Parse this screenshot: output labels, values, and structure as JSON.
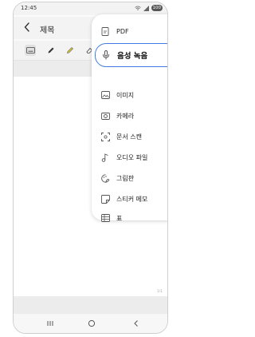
{
  "status_bar": {
    "time": "12:45",
    "battery": "100"
  },
  "header": {
    "title": "제목"
  },
  "attach_menu": {
    "items": [
      {
        "label": "PDF",
        "icon": "pdf-icon"
      },
      {
        "label": "음성 녹음",
        "icon": "microphone-icon",
        "highlighted": true
      },
      {
        "label": "이미지",
        "icon": "image-icon"
      },
      {
        "label": "카메라",
        "icon": "camera-icon"
      },
      {
        "label": "문서 스캔",
        "icon": "document-scan-icon"
      },
      {
        "label": "오디오 파일",
        "icon": "audio-file-icon"
      },
      {
        "label": "그림판",
        "icon": "drawing-pad-icon"
      },
      {
        "label": "스티커 메모",
        "icon": "sticky-note-icon"
      },
      {
        "label": "표",
        "icon": "table-icon"
      }
    ]
  },
  "page_indicator": "1/1",
  "colors": {
    "highlight_border": "#3f7ae6",
    "pencil_highlight": "#e8d12a"
  }
}
